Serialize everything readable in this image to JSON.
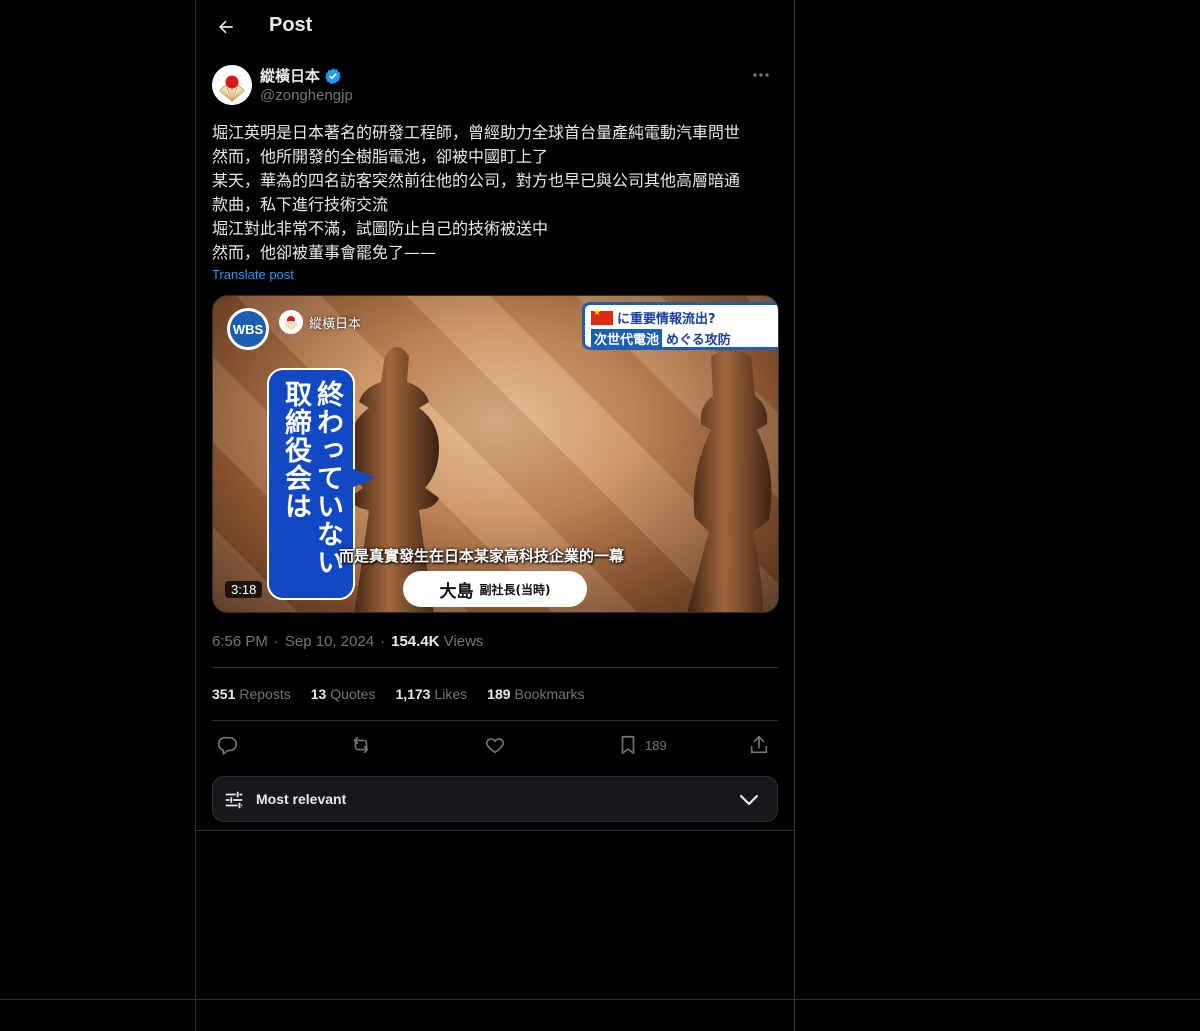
{
  "header": {
    "title": "Post"
  },
  "author": {
    "display_name": "縱橫日本",
    "handle": "@zonghengjp",
    "verified": true
  },
  "post": {
    "lines": [
      "堀江英明是日本著名的研發工程師，曾經助力全球首台量產純電動汽車問世",
      "然而，他所開發的全樹脂電池，卻被中國盯上了",
      "某天，華為的四名訪客突然前往他的公司，對方也早已與公司其他高層暗通",
      "款曲，私下進行技術交流",
      "堀江對此非常不滿，試圖防止自己的技術被送中",
      "然而，他卻被董事會罷免了——"
    ],
    "translate_label": "Translate post"
  },
  "video": {
    "logo": "WBS",
    "watermark": "縱橫日本",
    "banner_line1": "に重要情報流出?",
    "banner_highlight": "次世代電池",
    "banner_rest": "めぐる攻防",
    "bubble_col1": "取締役会は",
    "bubble_col2": "終わっていない",
    "subtitle": "而是真實發生在日本某家高科技企業的一幕",
    "nameplate_name": "大島",
    "nameplate_role": "副社長(当時)",
    "duration": "3:18"
  },
  "meta": {
    "time": "6:56 PM",
    "date": "Sep 10, 2024",
    "views_count": "154.4K",
    "views_label": "Views",
    "separator": "·"
  },
  "stats": {
    "reposts_count": "351",
    "reposts_label": "Reposts",
    "quotes_count": "13",
    "quotes_label": "Quotes",
    "likes_count": "1,173",
    "likes_label": "Likes",
    "bookmarks_count": "189",
    "bookmarks_label": "Bookmarks"
  },
  "actions": {
    "bookmark_count": "189"
  },
  "sort": {
    "label": "Most relevant"
  },
  "colors": {
    "background": "#000000",
    "text": "#e7e9ea",
    "muted": "#71767b",
    "accent": "#1d9bf0",
    "border": "#2f3336"
  }
}
